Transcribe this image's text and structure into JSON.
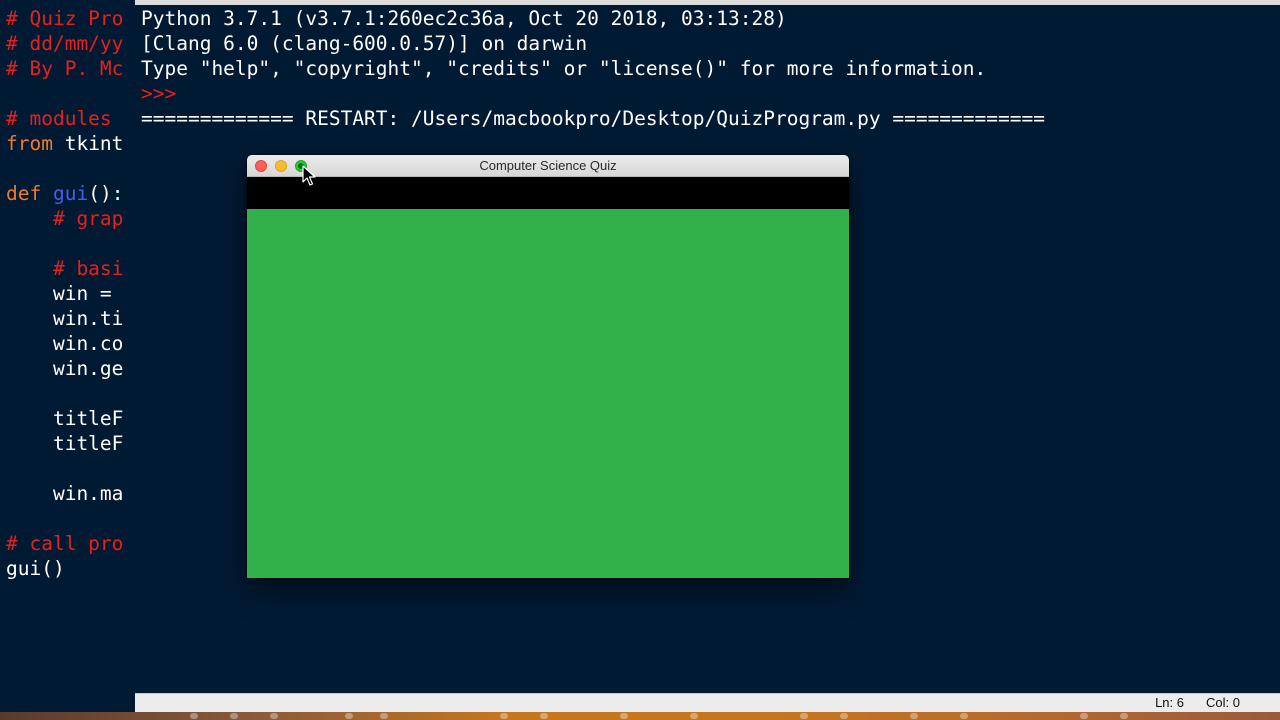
{
  "editor": {
    "lines": [
      [
        {
          "t": "# Quiz Pro",
          "c": "comment"
        }
      ],
      [
        {
          "t": "# dd/mm/yy",
          "c": "comment"
        }
      ],
      [
        {
          "t": "# By P. Mc",
          "c": "comment"
        }
      ],
      [],
      [
        {
          "t": "# modules ",
          "c": "comment"
        }
      ],
      [
        {
          "t": "from",
          "c": "keyword"
        },
        {
          "t": " tkint",
          "c": "plain"
        }
      ],
      [],
      [
        {
          "t": "def",
          "c": "keyword"
        },
        {
          "t": " ",
          "c": "plain"
        },
        {
          "t": "gui",
          "c": "def"
        },
        {
          "t": "():",
          "c": "plain"
        }
      ],
      [
        {
          "t": "    # grap",
          "c": "comment"
        }
      ],
      [],
      [
        {
          "t": "    # basi",
          "c": "comment"
        }
      ],
      [
        {
          "t": "    win = ",
          "c": "plain"
        }
      ],
      [
        {
          "t": "    win.ti",
          "c": "plain"
        }
      ],
      [
        {
          "t": "    win.co",
          "c": "plain"
        }
      ],
      [
        {
          "t": "    win.ge",
          "c": "plain"
        }
      ],
      [],
      [
        {
          "t": "    titleF",
          "c": "plain"
        }
      ],
      [
        {
          "t": "    titleF",
          "c": "plain"
        }
      ],
      [],
      [
        {
          "t": "    win.ma",
          "c": "plain"
        }
      ],
      [],
      [
        {
          "t": "# call pro",
          "c": "comment"
        }
      ],
      [
        {
          "t": "gui()",
          "c": "plain"
        }
      ]
    ]
  },
  "shell": {
    "lines": [
      {
        "text": "Python 3.7.1 (v3.7.1:260ec2c36a, Oct 20 2018, 03:13:28)",
        "kind": "out"
      },
      {
        "text": "[Clang 6.0 (clang-600.0.57)] on darwin",
        "kind": "out"
      },
      {
        "text": "Type \"help\", \"copyright\", \"credits\" or \"license()\" for more information.",
        "kind": "out"
      },
      {
        "text": ">>> ",
        "kind": "prompt"
      },
      {
        "text": "============= RESTART: /Users/macbookpro/Desktop/QuizProgram.py =============",
        "kind": "out"
      }
    ]
  },
  "status": {
    "ln": "Ln: 6",
    "col": "Col: 0"
  },
  "tk_window": {
    "title": "Computer Science Quiz",
    "header_color": "#000000",
    "body_color": "#32b04a"
  },
  "colors": {
    "background": "#011a33",
    "comment": "#e8201b",
    "keyword": "#f07a28",
    "def_name": "#4a5cf0"
  }
}
